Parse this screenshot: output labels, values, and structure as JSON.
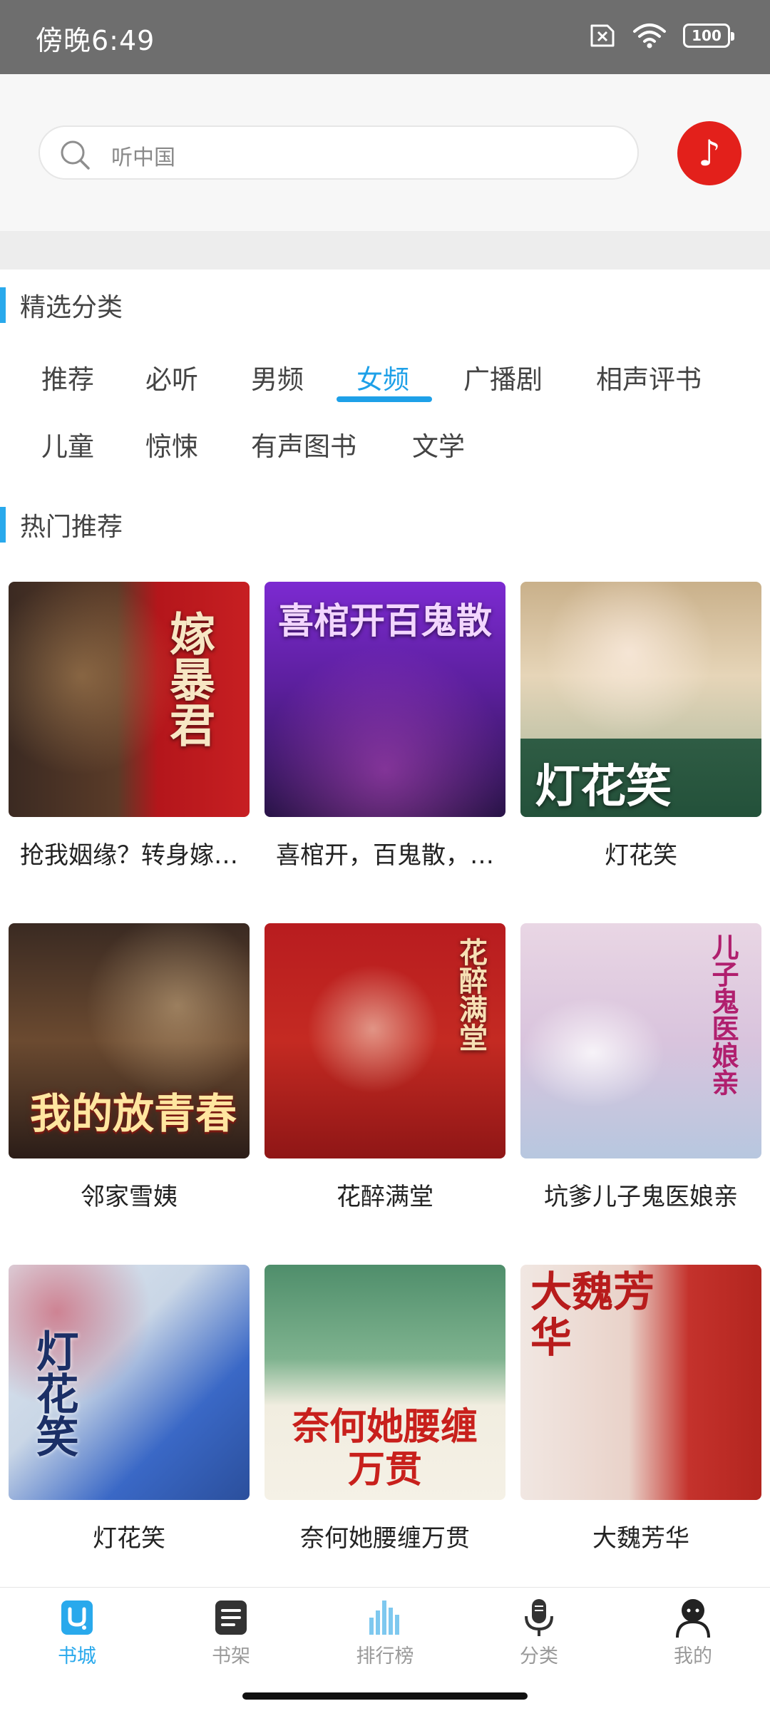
{
  "status_bar": {
    "time": "傍晚6:49",
    "battery": "100"
  },
  "search": {
    "placeholder": "听中国"
  },
  "music_button": {
    "icon": "music-note-icon",
    "glyph": "♪"
  },
  "sections": {
    "categories_title": "精选分类",
    "hot_title": "热门推荐"
  },
  "categories": [
    {
      "label": "推荐"
    },
    {
      "label": "必听"
    },
    {
      "label": "男频"
    },
    {
      "label": "女频",
      "active": true
    },
    {
      "label": "广播剧"
    },
    {
      "label": "相声评书"
    },
    {
      "label": "儿童"
    },
    {
      "label": "惊悚"
    },
    {
      "label": "有声图书"
    },
    {
      "label": "文学"
    }
  ],
  "books": [
    {
      "title": "抢我姻缘？转身嫁…",
      "cover_text": "嫁暴君"
    },
    {
      "title": "喜棺开，百鬼散，…",
      "cover_text": "喜棺开百鬼散"
    },
    {
      "title": "灯花笑",
      "cover_text": "灯花笑"
    },
    {
      "title": "邻家雪姨",
      "cover_text": "我的放青春"
    },
    {
      "title": "花醉满堂",
      "cover_text": "花醉满堂"
    },
    {
      "title": "坑爹儿子鬼医娘亲",
      "cover_text": "儿子鬼医娘亲"
    },
    {
      "title": "灯花笑",
      "cover_text": "灯花笑"
    },
    {
      "title": "奈何她腰缠万贯",
      "cover_text": "奈何她腰缠万贯"
    },
    {
      "title": "大魏芳华",
      "cover_text": "大魏芳华"
    }
  ],
  "bottom_nav": [
    {
      "label": "书城",
      "icon": "bookstore-icon",
      "active": true
    },
    {
      "label": "书架",
      "icon": "bookshelf-icon"
    },
    {
      "label": "排行榜",
      "icon": "ranking-chart-icon"
    },
    {
      "label": "分类",
      "icon": "microphone-icon"
    },
    {
      "label": "我的",
      "icon": "profile-icon"
    }
  ],
  "colors": {
    "accent": "#29a9ec",
    "music_button": "#e3201b",
    "status_bar": "#6e6e6e"
  }
}
